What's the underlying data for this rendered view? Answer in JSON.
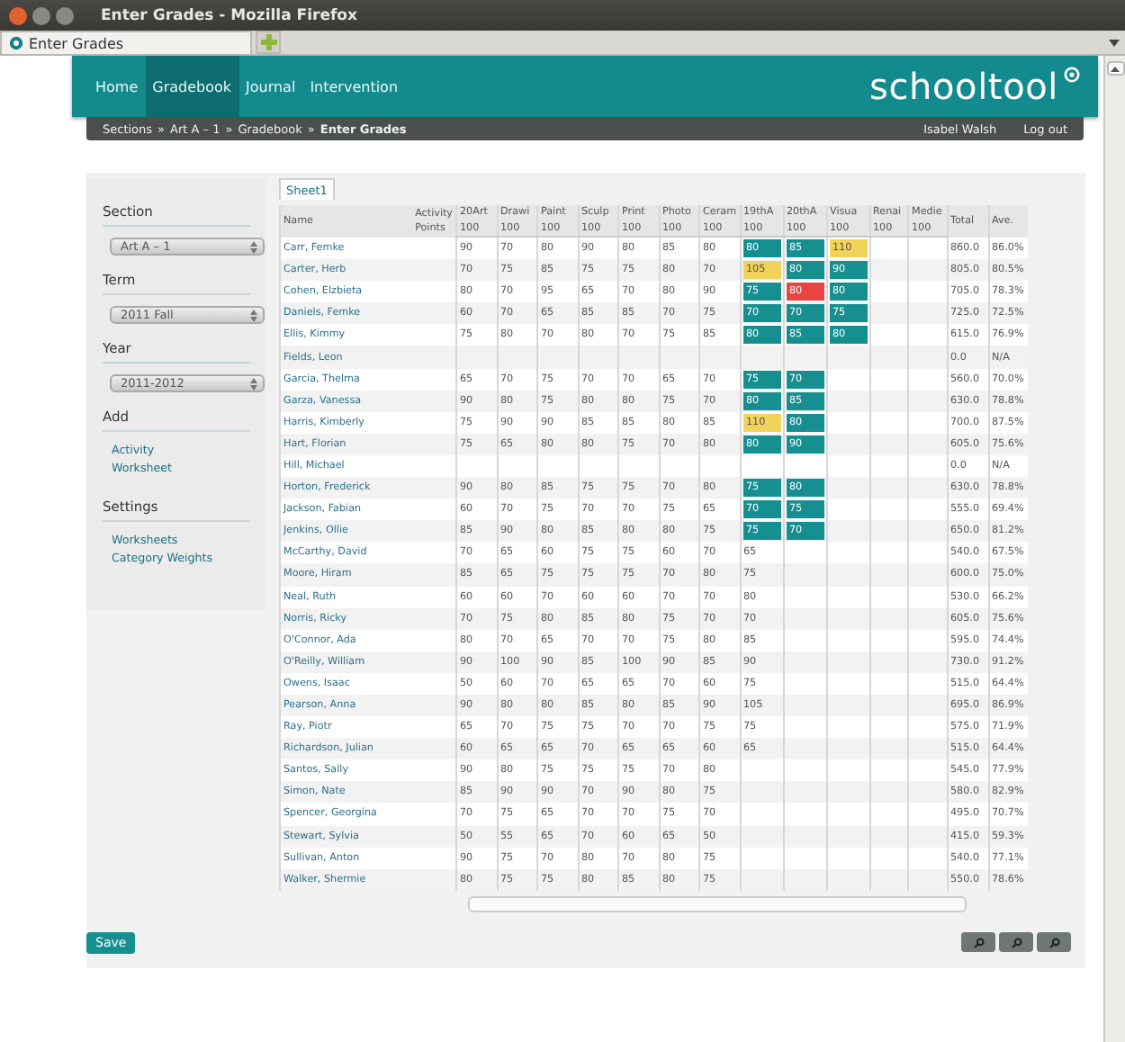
{
  "window": {
    "title": "Enter Grades - Mozilla Firefox"
  },
  "browser_tab": {
    "title": "Enter Grades"
  },
  "nav": {
    "items": [
      {
        "label": "Home",
        "selected": false
      },
      {
        "label": "Gradebook",
        "selected": true
      },
      {
        "label": "Journal",
        "selected": false
      },
      {
        "label": "Intervention",
        "selected": false
      }
    ],
    "logo": "schooltool"
  },
  "breadcrumb": {
    "items": [
      "Sections",
      "Art A – 1",
      "Gradebook"
    ],
    "separator": "»",
    "current": "Enter Grades",
    "user": "Isabel Walsh",
    "logout": "Log out"
  },
  "sidebar": {
    "sections": [
      {
        "kind": "select",
        "title": "Section",
        "value": "Art A – 1"
      },
      {
        "kind": "select",
        "title": "Term",
        "value": "2011 Fall"
      },
      {
        "kind": "select",
        "title": "Year",
        "value": "2011-2012"
      },
      {
        "kind": "links",
        "title": "Add",
        "links": [
          "Activity",
          "Worksheet"
        ]
      },
      {
        "kind": "links",
        "title": "Settings",
        "links": [
          "Worksheets",
          "Category Weights"
        ]
      }
    ]
  },
  "sheet_tabs": [
    {
      "label": "Sheet1",
      "selected": true
    }
  ],
  "table": {
    "name_header": "Name",
    "activity_label": "Activity",
    "points_label": "Points",
    "total_header": "Total",
    "average_header": "Ave.",
    "columns": [
      {
        "title": "20Art",
        "points": "100"
      },
      {
        "title": "Drawi",
        "points": "100"
      },
      {
        "title": "Paint",
        "points": "100"
      },
      {
        "title": "Sculp",
        "points": "100"
      },
      {
        "title": "Print",
        "points": "100"
      },
      {
        "title": "Photo",
        "points": "100"
      },
      {
        "title": "Ceram",
        "points": "100"
      },
      {
        "title": "19thA",
        "points": "100"
      },
      {
        "title": "20thA",
        "points": "100"
      },
      {
        "title": "Visua",
        "points": "100"
      },
      {
        "title": "Renai",
        "points": "100"
      },
      {
        "title": "Medie",
        "points": "100"
      }
    ],
    "rows": [
      {
        "name": "Carr, Femke",
        "scores": [
          "90",
          "70",
          "80",
          "90",
          "80",
          "85",
          "80",
          {
            "value": "80",
            "color": "#168f90"
          },
          {
            "value": "85",
            "color": "#168f90"
          },
          {
            "value": "110",
            "color": "#f1d35a"
          }
        ],
        "total": "860.0",
        "average": "86.0%"
      },
      {
        "name": "Carter, Herb",
        "scores": [
          "70",
          "75",
          "85",
          "75",
          "75",
          "80",
          "70",
          {
            "value": "105",
            "color": "#f1d35a"
          },
          {
            "value": "80",
            "color": "#168f90"
          },
          {
            "value": "90",
            "color": "#168f90"
          }
        ],
        "total": "805.0",
        "average": "80.5%"
      },
      {
        "name": "Cohen, Elzbieta",
        "scores": [
          "80",
          "70",
          "95",
          "65",
          "70",
          "80",
          "90",
          {
            "value": "75",
            "color": "#168f90"
          },
          {
            "value": "80",
            "color": "#e84442"
          },
          {
            "value": "80",
            "color": "#168f90"
          }
        ],
        "total": "705.0",
        "average": "78.3%"
      },
      {
        "name": "Daniels, Femke",
        "scores": [
          "60",
          "70",
          "65",
          "85",
          "85",
          "70",
          "75",
          {
            "value": "70",
            "color": "#168f90"
          },
          {
            "value": "70",
            "color": "#168f90"
          },
          {
            "value": "75",
            "color": "#168f90"
          }
        ],
        "total": "725.0",
        "average": "72.5%"
      },
      {
        "name": "Ellis, Kimmy",
        "scores": [
          "75",
          "80",
          "70",
          "80",
          "70",
          "75",
          "85",
          {
            "value": "80",
            "color": "#168f90"
          },
          {
            "value": "85",
            "color": "#168f90"
          },
          {
            "value": "80",
            "color": "#168f90"
          }
        ],
        "total": "615.0",
        "average": "76.9%"
      },
      {
        "name": "Fields, Leon",
        "total": "0.0",
        "average": "N/A"
      },
      {
        "name": "Garcia, Thelma",
        "scores": [
          "65",
          "70",
          "75",
          "70",
          "70",
          "65",
          "70",
          {
            "value": "75",
            "color": "#168f90"
          },
          {
            "value": "70",
            "color": "#168f90"
          }
        ],
        "total": "560.0",
        "average": "70.0%"
      },
      {
        "name": "Garza, Vanessa",
        "scores": [
          "90",
          "80",
          "75",
          "80",
          "80",
          "75",
          "70",
          {
            "value": "80",
            "color": "#168f90"
          },
          {
            "value": "85",
            "color": "#168f90"
          }
        ],
        "total": "630.0",
        "average": "78.8%"
      },
      {
        "name": "Harris, Kimberly",
        "scores": [
          "75",
          "90",
          "90",
          "85",
          "85",
          "80",
          "85",
          {
            "value": "110",
            "color": "#f1d35a"
          },
          {
            "value": "80",
            "color": "#168f90"
          }
        ],
        "total": "700.0",
        "average": "87.5%"
      },
      {
        "name": "Hart, Florian",
        "scores": [
          "75",
          "65",
          "80",
          "80",
          "75",
          "70",
          "80",
          {
            "value": "80",
            "color": "#168f90"
          },
          {
            "value": "90",
            "color": "#168f90"
          }
        ],
        "total": "605.0",
        "average": "75.6%"
      },
      {
        "name": "Hill, Michael",
        "total": "0.0",
        "average": "N/A"
      },
      {
        "name": "Horton, Frederick",
        "scores": [
          "90",
          "80",
          "85",
          "75",
          "75",
          "70",
          "80",
          {
            "value": "75",
            "color": "#168f90"
          },
          {
            "value": "80",
            "color": "#168f90"
          }
        ],
        "total": "630.0",
        "average": "78.8%"
      },
      {
        "name": "Jackson, Fabian",
        "scores": [
          "60",
          "70",
          "75",
          "70",
          "70",
          "75",
          "65",
          {
            "value": "70",
            "color": "#168f90"
          },
          {
            "value": "75",
            "color": "#168f90"
          }
        ],
        "total": "555.0",
        "average": "69.4%"
      },
      {
        "name": "Jenkins, Ollie",
        "scores": [
          "85",
          "90",
          "80",
          "85",
          "80",
          "80",
          "75",
          {
            "value": "75",
            "color": "#168f90"
          },
          {
            "value": "70",
            "color": "#168f90"
          }
        ],
        "total": "650.0",
        "average": "81.2%"
      },
      {
        "name": "McCarthy, David",
        "scores": [
          "70",
          "65",
          "60",
          "75",
          "75",
          "60",
          "70",
          "65"
        ],
        "total": "540.0",
        "average": "67.5%"
      },
      {
        "name": "Moore, Hiram",
        "scores": [
          "85",
          "65",
          "75",
          "75",
          "75",
          "70",
          "80",
          "75"
        ],
        "total": "600.0",
        "average": "75.0%"
      },
      {
        "name": "Neal, Ruth",
        "scores": [
          "60",
          "60",
          "70",
          "60",
          "60",
          "70",
          "70",
          "80"
        ],
        "total": "530.0",
        "average": "66.2%"
      },
      {
        "name": "Norris, Ricky",
        "scores": [
          "70",
          "75",
          "80",
          "85",
          "80",
          "75",
          "70",
          "70"
        ],
        "total": "605.0",
        "average": "75.6%"
      },
      {
        "name": "O'Connor, Ada",
        "scores": [
          "80",
          "70",
          "65",
          "70",
          "70",
          "75",
          "80",
          "85"
        ],
        "total": "595.0",
        "average": "74.4%"
      },
      {
        "name": "O'Reilly, William",
        "scores": [
          "90",
          "100",
          "90",
          "85",
          "100",
          "90",
          "85",
          "90"
        ],
        "total": "730.0",
        "average": "91.2%"
      },
      {
        "name": "Owens, Isaac",
        "scores": [
          "50",
          "60",
          "70",
          "65",
          "65",
          "70",
          "60",
          "75"
        ],
        "total": "515.0",
        "average": "64.4%"
      },
      {
        "name": "Pearson, Anna",
        "scores": [
          "90",
          "80",
          "80",
          "85",
          "80",
          "85",
          "90",
          "105"
        ],
        "total": "695.0",
        "average": "86.9%"
      },
      {
        "name": "Ray, Piotr",
        "scores": [
          "65",
          "70",
          "75",
          "75",
          "70",
          "70",
          "75",
          "75"
        ],
        "total": "575.0",
        "average": "71.9%"
      },
      {
        "name": "Richardson, Julian",
        "scores": [
          "60",
          "65",
          "65",
          "70",
          "65",
          "65",
          "60",
          "65"
        ],
        "total": "515.0",
        "average": "64.4%"
      },
      {
        "name": "Santos, Sally",
        "scores": [
          "90",
          "80",
          "75",
          "75",
          "75",
          "70",
          "80"
        ],
        "total": "545.0",
        "average": "77.9%"
      },
      {
        "name": "Simon, Nate",
        "scores": [
          "85",
          "90",
          "90",
          "70",
          "90",
          "80",
          "75"
        ],
        "total": "580.0",
        "average": "82.9%"
      },
      {
        "name": "Spencer, Georgina",
        "scores": [
          "70",
          "75",
          "65",
          "70",
          "70",
          "75",
          "70"
        ],
        "total": "495.0",
        "average": "70.7%"
      },
      {
        "name": "Stewart, Sylvia",
        "scores": [
          "50",
          "55",
          "65",
          "70",
          "60",
          "65",
          "50"
        ],
        "total": "415.0",
        "average": "59.3%"
      },
      {
        "name": "Sullivan, Anton",
        "scores": [
          "90",
          "75",
          "70",
          "80",
          "70",
          "80",
          "75"
        ],
        "total": "540.0",
        "average": "77.1%"
      },
      {
        "name": "Walker, Shermie",
        "scores": [
          "80",
          "75",
          "75",
          "80",
          "85",
          "80",
          "75"
        ],
        "total": "550.0",
        "average": "78.6%"
      }
    ]
  },
  "save_button": "Save"
}
